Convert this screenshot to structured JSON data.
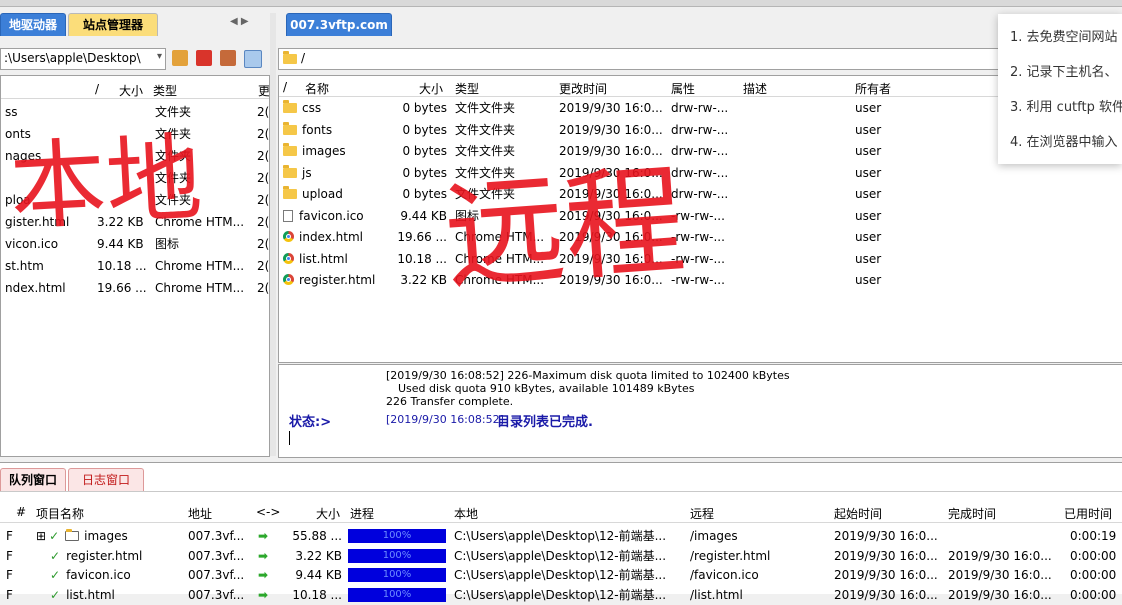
{
  "left_tabs": [
    "地驱动器",
    "站点管理器"
  ],
  "right_tab": "007.3vftp.com",
  "left_path": ":\\Users\\apple\\Desktop\\",
  "right_path": "/",
  "left_headers": {
    "sort": "/",
    "size": "大小",
    "type": "类型",
    "more": "更"
  },
  "left_files": [
    {
      "name": "ss",
      "size": "",
      "type": "文件夹",
      "date": "2("
    },
    {
      "name": "onts",
      "size": "",
      "type": "文件夹",
      "date": "2("
    },
    {
      "name": "nages",
      "size": "",
      "type": "文件夹",
      "date": "2("
    },
    {
      "name": "",
      "size": "",
      "type": "文件夹",
      "date": "2("
    },
    {
      "name": "ploa",
      "size": "",
      "type": "文件夹",
      "date": "2("
    },
    {
      "name": "gister.html",
      "size": "3.22 KB",
      "type": "Chrome HTM...",
      "date": "2("
    },
    {
      "name": "vicon.ico",
      "size": "9.44 KB",
      "type": "图标",
      "date": "2("
    },
    {
      "name": "st.htm",
      "size": "10.18 ...",
      "type": "Chrome HTM...",
      "date": "2("
    },
    {
      "name": "ndex.html",
      "size": "19.66 ...",
      "type": "Chrome HTM...",
      "date": "2("
    }
  ],
  "right_headers": {
    "sort": "/",
    "name": "名称",
    "size": "大小",
    "type": "类型",
    "modified": "更改时间",
    "attr": "属性",
    "desc": "描述",
    "owner": "所有者"
  },
  "right_files": [
    {
      "icon": "folder",
      "name": "css",
      "size": "0 bytes",
      "type": "文件文件夹",
      "modified": "2019/9/30 16:0...",
      "attr": "drw-rw-...",
      "owner": "user"
    },
    {
      "icon": "folder",
      "name": "fonts",
      "size": "0 bytes",
      "type": "文件文件夹",
      "modified": "2019/9/30 16:0...",
      "attr": "drw-rw-...",
      "owner": "user"
    },
    {
      "icon": "folder",
      "name": "images",
      "size": "0 bytes",
      "type": "文件文件夹",
      "modified": "2019/9/30 16:0...",
      "attr": "drw-rw-...",
      "owner": "user"
    },
    {
      "icon": "folder",
      "name": "js",
      "size": "0 bytes",
      "type": "文件文件夹",
      "modified": "2019/9/30 16:0...",
      "attr": "drw-rw-...",
      "owner": "user"
    },
    {
      "icon": "folder",
      "name": "upload",
      "size": "0 bytes",
      "type": "文件文件夹",
      "modified": "2019/9/30 16:0...",
      "attr": "drw-rw-...",
      "owner": "user"
    },
    {
      "icon": "file",
      "name": "favicon.ico",
      "size": "9.44 KB",
      "type": "图标",
      "modified": "2019/9/30 16:0...",
      "attr": "-rw-rw-...",
      "owner": "user"
    },
    {
      "icon": "chrome",
      "name": "index.html",
      "size": "19.66 ...",
      "type": "Chrome HTM...",
      "modified": "2019/9/30 16:0...",
      "attr": "-rw-rw-...",
      "owner": "user"
    },
    {
      "icon": "chrome",
      "name": "list.html",
      "size": "10.18 ...",
      "type": "Chrome HTM...",
      "modified": "2019/9/30 16:0...",
      "attr": "-rw-rw-...",
      "owner": "user"
    },
    {
      "icon": "chrome",
      "name": "register.html",
      "size": "3.22 KB",
      "type": "Chrome HTM...",
      "modified": "2019/9/30 16:0...",
      "attr": "-rw-rw-...",
      "owner": "user"
    }
  ],
  "log": {
    "line1": "[2019/9/30 16:08:52] 226-Maximum disk quota limited to 102400 kBytes",
    "line2": "Used disk quota 910 kBytes, available 101489 kBytes",
    "line3": "226 Transfer complete.",
    "status_label": "状态:>",
    "status_time": "[2019/9/30 16:08:52]",
    "status_msg": "目录列表已完成."
  },
  "bottom_tabs": [
    "队列窗口",
    "日志窗口"
  ],
  "queue_headers": {
    "num": "#",
    "name": "项目名称",
    "addr": "地址",
    "dir": "<->",
    "size": "大小",
    "progress": "进程",
    "local": "本地",
    "remote": "远程",
    "start": "起始时间",
    "end": "完成时间",
    "elapsed": "已用时间"
  },
  "queue": [
    {
      "flag": "F",
      "expand": "⊞",
      "folder": true,
      "name": "images",
      "addr": "007.3vf...",
      "size": "55.88 ...",
      "progress": "100%",
      "local": "C:\\Users\\apple\\Desktop\\12-前端基...",
      "remote": "/images",
      "start": "2019/9/30 16:0...",
      "end": "",
      "elapsed": "0:00:19"
    },
    {
      "flag": "F",
      "expand": "",
      "folder": false,
      "name": "register.html",
      "addr": "007.3vf...",
      "size": "3.22 KB",
      "progress": "100%",
      "local": "C:\\Users\\apple\\Desktop\\12-前端基...",
      "remote": "/register.html",
      "start": "2019/9/30 16:0...",
      "end": "2019/9/30 16:0...",
      "elapsed": "0:00:00"
    },
    {
      "flag": "F",
      "expand": "",
      "folder": false,
      "name": "favicon.ico",
      "addr": "007.3vf...",
      "size": "9.44 KB",
      "progress": "100%",
      "local": "C:\\Users\\apple\\Desktop\\12-前端基...",
      "remote": "/favicon.ico",
      "start": "2019/9/30 16:0...",
      "end": "2019/9/30 16:0...",
      "elapsed": "0:00:00"
    },
    {
      "flag": "F",
      "expand": "",
      "folder": false,
      "name": "list.html",
      "addr": "007.3vf...",
      "size": "10.18 ...",
      "progress": "100%",
      "local": "C:\\Users\\apple\\Desktop\\12-前端基...",
      "remote": "/list.html",
      "start": "2019/9/30 16:0...",
      "end": "2019/9/30 16:0...",
      "elapsed": "0:00:00"
    }
  ],
  "popup_steps": [
    "1. 去免费空间网站",
    "2. 记录下主机名、",
    "3. 利用 cutftp 软件",
    "4. 在浏览器中输入"
  ],
  "annotations": {
    "left": "本地",
    "right": "远程"
  },
  "colors": {
    "accent_blue": "#0000dd",
    "tab_active": "#3c7fd8",
    "annotation_red": "#e8141e"
  }
}
